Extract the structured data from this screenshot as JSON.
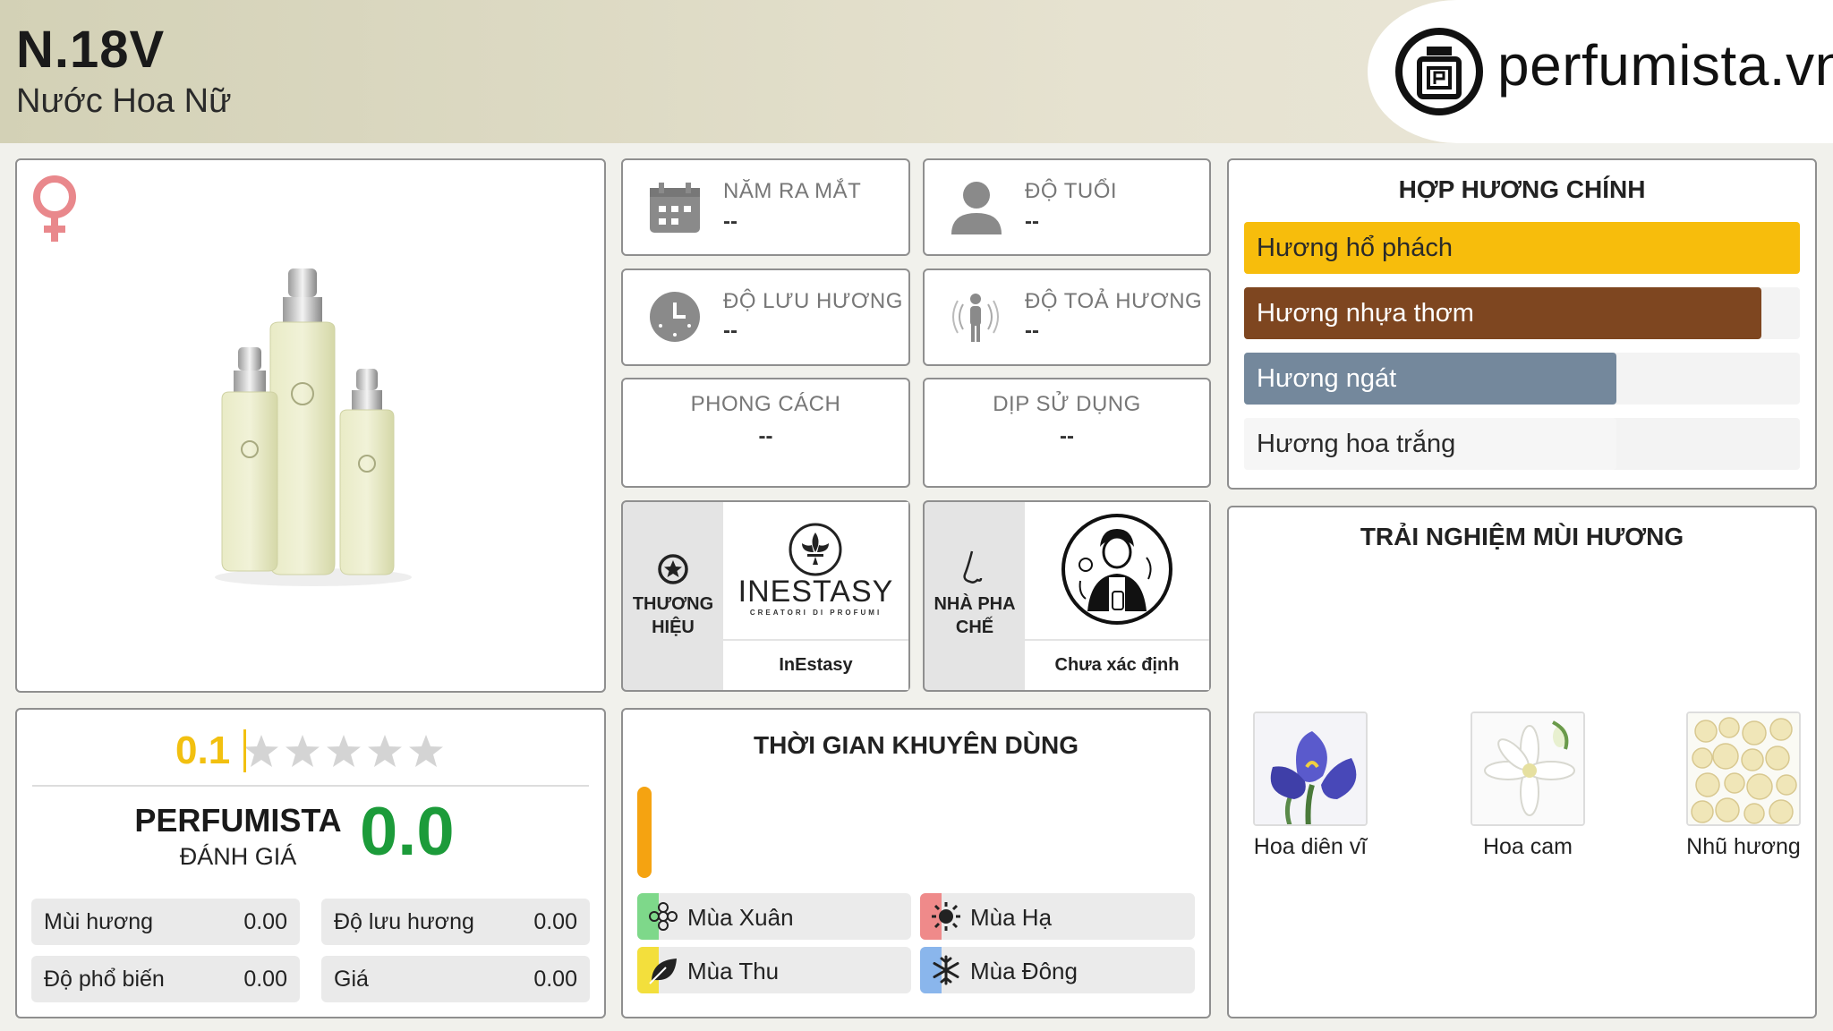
{
  "header": {
    "title": "N.18V",
    "subtitle": "Nước Hoa Nữ",
    "brand_site": "perfumista.vn"
  },
  "info": {
    "release_year": {
      "label": "NĂM RA MẮT",
      "value": "--"
    },
    "age": {
      "label": "ĐỘ TUỔI",
      "value": "--"
    },
    "longevity": {
      "label": "ĐỘ LƯU HƯƠNG",
      "value": "--"
    },
    "sillage": {
      "label": "ĐỘ TOẢ HƯƠNG",
      "value": "--"
    },
    "style": {
      "label": "PHONG CÁCH",
      "value": "--"
    },
    "occasion": {
      "label": "DỊP SỬ DỤNG",
      "value": "--"
    },
    "brand": {
      "label_line1": "THƯƠNG",
      "label_line2": "HIỆU",
      "logo_text": "INESTASY",
      "logo_sub": "CREATORI DI PROFUMI",
      "name": "InEstasy"
    },
    "perfumer": {
      "label_line1": "NHÀ PHA",
      "label_line2": "CHẾ",
      "name": "Chưa xác định"
    }
  },
  "accords": {
    "title": "HỢP HƯƠNG CHÍNH",
    "items": [
      {
        "label": "Hương hổ phách",
        "fill": 1.0,
        "color": "#f7bd0c",
        "text_color": "#2a2a2a"
      },
      {
        "label": "Hương nhựa thơm",
        "fill": 0.93,
        "color": "#7e4620",
        "text_color": "#ffffff"
      },
      {
        "label": "Hương ngát",
        "fill": 0.67,
        "color": "#74889c",
        "text_color": "#ffffff"
      },
      {
        "label": "Hương hoa trắng",
        "fill": 0.67,
        "color": "#f6f6f6",
        "text_color": "#2a2a2a"
      }
    ]
  },
  "rating": {
    "user_score": "0.1",
    "stars": 0.02,
    "perfumista_label": "PERFUMISTA",
    "perfumista_sub": "ĐÁNH GIÁ",
    "perfumista_score": "0.0",
    "breakdown": [
      {
        "label": "Mùi hương",
        "value": "0.00"
      },
      {
        "label": "Độ lưu hương",
        "value": "0.00"
      },
      {
        "label": "Độ phổ biến",
        "value": "0.00"
      },
      {
        "label": "Giá",
        "value": "0.00"
      }
    ]
  },
  "usage_time": {
    "title": "THỜI GIAN KHUYÊN DÙNG",
    "seasons": [
      {
        "label": "Mùa Xuân",
        "color": "#7ed88a",
        "icon": "flower-icon"
      },
      {
        "label": "Mùa Hạ",
        "color": "#ef8a8a",
        "icon": "sun-icon"
      },
      {
        "label": "Mùa Thu",
        "color": "#f3df3c",
        "icon": "leaf-icon"
      },
      {
        "label": "Mùa Đông",
        "color": "#8ab6ec",
        "icon": "snowflake-icon"
      }
    ]
  },
  "experience": {
    "title": "TRẢI NGHIỆM MÙI HƯƠNG",
    "notes": [
      {
        "label": "Hoa diên vĩ"
      },
      {
        "label": "Hoa cam"
      },
      {
        "label": "Nhũ hương"
      }
    ]
  }
}
